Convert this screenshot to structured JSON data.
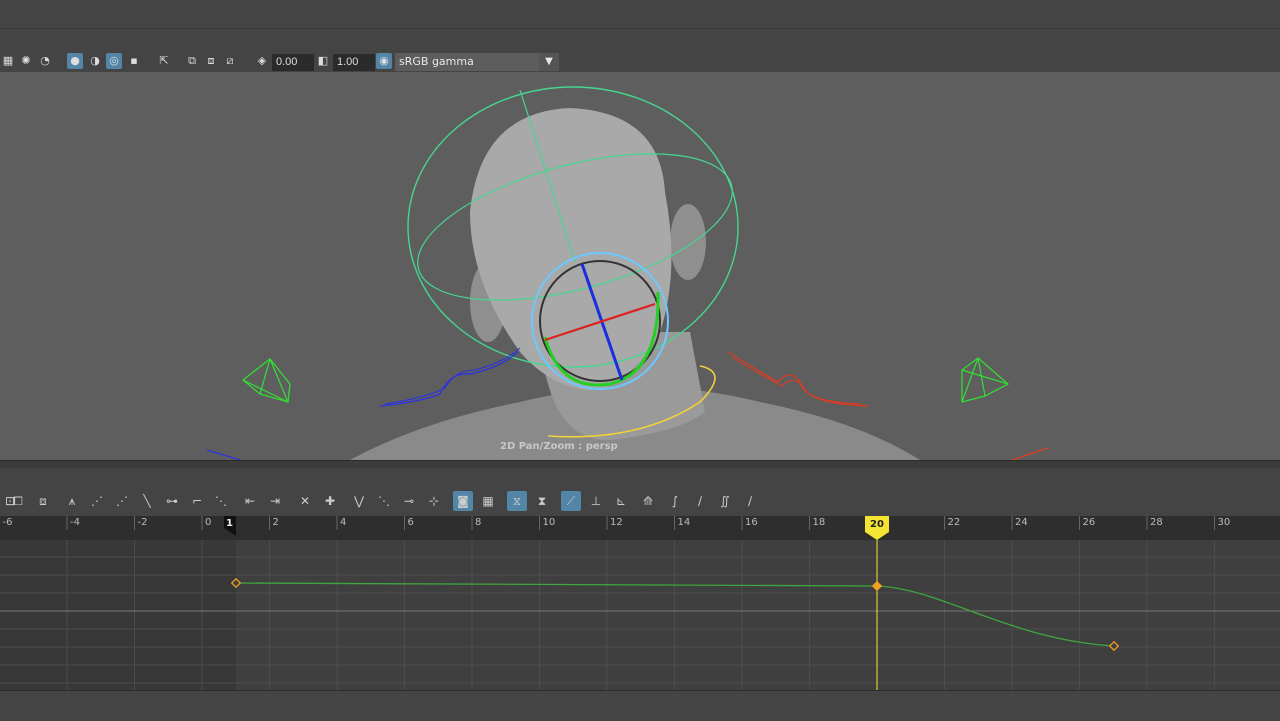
{
  "toolbar": {
    "exposure_value": "0.00",
    "gamma_value": "1.00",
    "color_space": "sRGB gamma"
  },
  "viewport": {
    "label": "2D Pan/Zoom : persp"
  },
  "graph_editor": {
    "ruler_ticks": [
      "-6",
      "-4",
      "-2",
      "0",
      "2",
      "4",
      "6",
      "8",
      "10",
      "12",
      "14",
      "16",
      "18",
      "22",
      "24",
      "26",
      "28",
      "30"
    ],
    "start_frame_marker": "1",
    "current_frame": "20",
    "curve_color": "#3fa53f",
    "current_time_color": "#f5e431",
    "keyframe_color": "#f0a020"
  },
  "icons": {
    "toolbar": [
      "checker-icon",
      "light-icon",
      "shadow-icon",
      "shading-icon",
      "xray-icon",
      "isolate-icon",
      "grid-icon",
      "select-icon",
      "resolution-icon",
      "gate-icon",
      "safe-frame-icon",
      "exposure-icon",
      "gamma-icon",
      "color-management-icon"
    ],
    "graph_editor": [
      "frame-all-icon",
      "frame-playback-icon",
      "center-icon",
      "move-key-icon",
      "insert-key-icon",
      "lattice-icon",
      "region-icon",
      "spline-tangent-icon",
      "clamped-tangent-icon",
      "linear-tangent-icon",
      "flat-tangent-icon",
      "step-tangent-icon",
      "plateau-tangent-icon",
      "in-tangent-icon",
      "out-tangent-icon",
      "break-tangent-icon",
      "unify-tangent-icon",
      "free-weight-icon",
      "lock-weight-icon",
      "buffer-curve-icon",
      "swap-buffer-icon",
      "auto-load-icon",
      "snap-icon",
      "normalize-icon",
      "denormalize-icon",
      "pre-infinity-icon",
      "post-infinity-icon",
      "cycle-icon",
      "cycle-offset-icon",
      "oscillate-icon",
      "linear-infinity-icon"
    ]
  }
}
